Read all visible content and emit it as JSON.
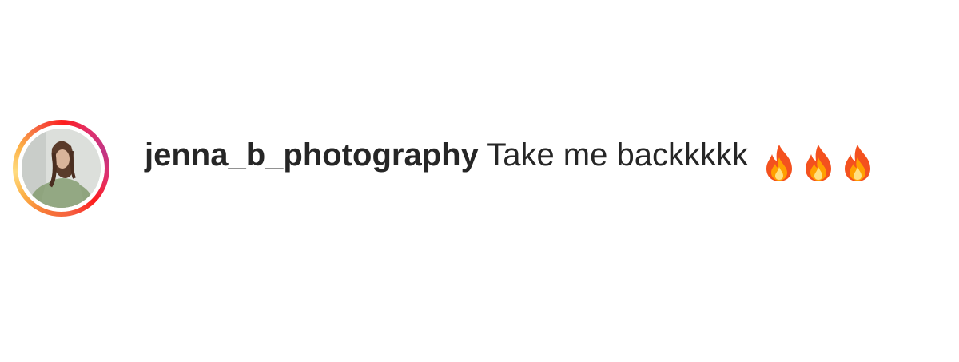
{
  "comment": {
    "username": "jenna_b_photography",
    "text": "Take me backkkkk",
    "emojis": [
      "fire-icon",
      "fire-icon",
      "fire-icon"
    ]
  },
  "colors": {
    "text": "#262626",
    "story_ring_start": "#f77737",
    "story_ring_end": "#c13584"
  }
}
